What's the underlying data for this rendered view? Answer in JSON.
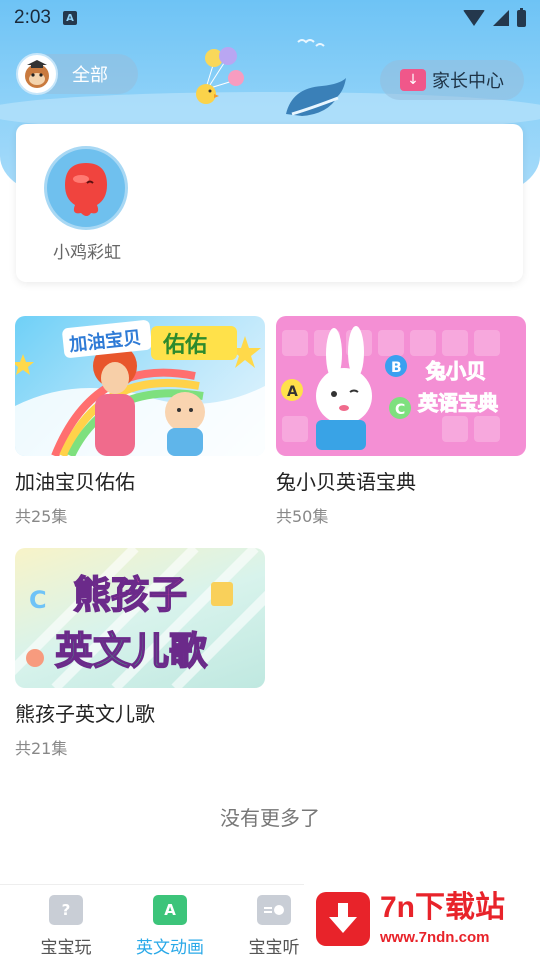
{
  "status_bar": {
    "time": "2:03",
    "notification_icon": "A"
  },
  "header": {
    "filter_label": "全部",
    "parent_center_label": "家长中心"
  },
  "character": {
    "name": "小鸡彩虹"
  },
  "videos": [
    {
      "title": "加油宝贝佑佑",
      "count": "共25集",
      "thumb_text": [
        "加油宝贝",
        "佑佑"
      ]
    },
    {
      "title": "兔小贝英语宝典",
      "count": "共50集",
      "thumb_text": [
        "兔小贝",
        "英语宝典"
      ]
    },
    {
      "title": "熊孩子英文儿歌",
      "count": "共21集",
      "thumb_text": [
        "熊孩子",
        "英文儿歌"
      ]
    }
  ],
  "footer_note": "没有更多了",
  "bottom_nav": [
    {
      "label": "宝宝玩",
      "icon": "calendar-icon",
      "active": false
    },
    {
      "label": "英文动画",
      "icon": "letter-a-icon",
      "active": true
    },
    {
      "label": "宝宝听",
      "icon": "radio-icon",
      "active": false
    }
  ],
  "watermark": {
    "title": "7n下载站",
    "url": "www.7ndn.com"
  },
  "colors": {
    "sky": "#8fd2f8",
    "active_nav": "#2aa9e8",
    "watermark_red": "#e8232a"
  }
}
